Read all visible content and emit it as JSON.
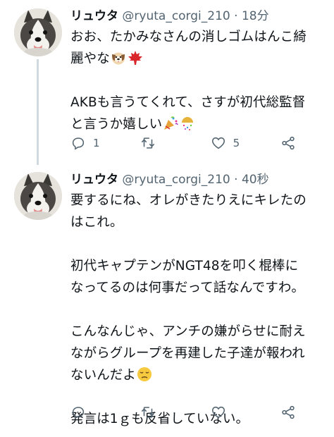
{
  "tweets": [
    {
      "display_name": "リュウタ",
      "handle": "@ryuta_corgi_210",
      "separator": "·",
      "time": "18分",
      "lines": [
        "おお、たかみなさんの消しゴムはんこ綺",
        "麗やな",
        "",
        "AKBも言うてくれて、さすが初代総監督",
        "と言うか嬉しい"
      ],
      "emojis": [
        "dog-face",
        "maple-leaf",
        "party-popper",
        "confetti-ball"
      ],
      "reply_count": "1",
      "retweet_count": "",
      "like_count": "5"
    },
    {
      "display_name": "リュウタ",
      "handle": "@ryuta_corgi_210",
      "separator": "·",
      "time": "40秒",
      "lines": [
        "要するにね、オレがきたりえにキレたの",
        "はこれ。",
        "",
        "初代キャプテンがNGT48を叩く棍棒に",
        "なってるのは何事だって話なんですわ。",
        "",
        "こんなんじゃ、アンチの嫌がらせに耐え",
        "ながらグループを再建した子達が報われ",
        "ないんだよ",
        "",
        "発言は1ｇも反省していない。"
      ],
      "emojis": [
        "pensive-face"
      ],
      "reply_count": "",
      "retweet_count": "",
      "like_count": ""
    }
  ]
}
